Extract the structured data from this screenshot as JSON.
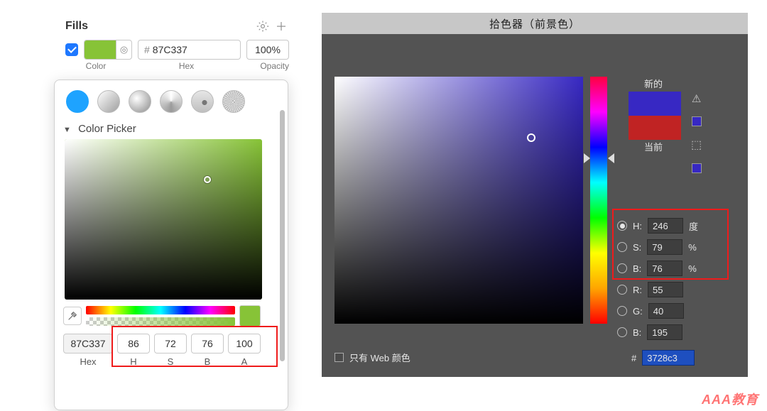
{
  "left": {
    "section_title": "Fills",
    "sub": {
      "color": "Color",
      "hex": "Hex",
      "opacity": "Opacity"
    },
    "hex": "87C337",
    "opacity": "100%",
    "swatch_color": "#87C337",
    "popover": {
      "title": "Color Picker",
      "hex": "87C337",
      "h": "86",
      "s": "72",
      "b": "76",
      "a": "100",
      "labels": {
        "hex": "Hex",
        "h": "H",
        "s": "S",
        "b": "B",
        "a": "A"
      }
    }
  },
  "right": {
    "title": "拾色器（前景色）",
    "new_label": "新的",
    "current_label": "当前",
    "new_color": "#3728c3",
    "current_color": "#c02323",
    "fields": {
      "h": {
        "label": "H:",
        "value": "246",
        "unit": "度"
      },
      "s": {
        "label": "S:",
        "value": "79",
        "unit": "%"
      },
      "b": {
        "label": "B:",
        "value": "76",
        "unit": "%"
      },
      "r": {
        "label": "R:",
        "value": "55",
        "unit": ""
      },
      "g": {
        "label": "G:",
        "value": "40",
        "unit": ""
      },
      "b2": {
        "label": "B:",
        "value": "195",
        "unit": ""
      },
      "hex": {
        "label": "#",
        "value": "3728c3"
      }
    },
    "web_only": "只有 Web 颜色"
  },
  "watermark": "AAA教育"
}
